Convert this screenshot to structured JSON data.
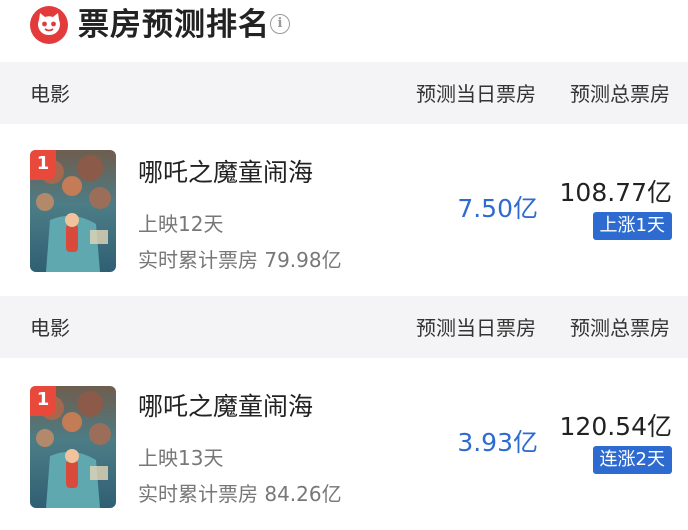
{
  "header": {
    "title": "票房预测排名",
    "info_glyph": "i"
  },
  "columns": {
    "movie": "电影",
    "day_forecast": "预测当日票房",
    "total_forecast": "预测总票房"
  },
  "rows": [
    {
      "rank": "1",
      "name": "哪吒之魔童闹海",
      "days": "上映12天",
      "cumulative": "实时累计票房 79.98亿",
      "day_forecast": "7.50亿",
      "total_forecast": "108.77亿",
      "trend": "上涨1天"
    },
    {
      "rank": "1",
      "name": "哪吒之魔童闹海",
      "days": "上映13天",
      "cumulative": "实时累计票房 84.26亿",
      "day_forecast": "3.93亿",
      "total_forecast": "120.54亿",
      "trend": "连涨2天"
    }
  ],
  "colors": {
    "brand_red": "#e33b3b",
    "accent_blue": "#2e6bd1",
    "header_bg": "#f4f4f6"
  }
}
